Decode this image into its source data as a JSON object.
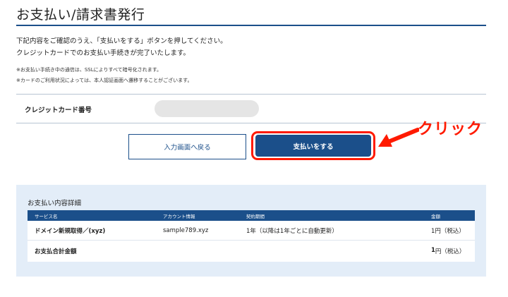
{
  "header": {
    "title": "お支払い/請求書発行"
  },
  "intro": {
    "line1": "下記内容をご確認のうえ、「支払いをする」ボタンを押してください。",
    "line2": "クレジットカードでのお支払い手続きが完了いたします。"
  },
  "notes": {
    "note1": "※お支払い手続き中の通信は、SSLによりすべて暗号化されます。",
    "note2": "※カードのご利用状況によっては、本人認証画面へ遷移することがございます。"
  },
  "card": {
    "label": "クレジットカード番号",
    "value": ""
  },
  "actions": {
    "back_label": "入力画面へ戻る",
    "pay_label": "支払いをする"
  },
  "annotation": {
    "text": "クリック",
    "color": "#ff1a00"
  },
  "details": {
    "title": "お支払い内容詳細",
    "columns": [
      "サービス名",
      "アカウント情報",
      "契約期間",
      "金額"
    ],
    "rows": [
      {
        "service": "ドメイン新規取得／(xyz)",
        "account": "sample789.xyz",
        "period": "1年（以降は1年ごとに自動更新）",
        "amount": "1円（税込）"
      }
    ],
    "total": {
      "label": "お支払合計金額",
      "amount_number": "1",
      "amount_suffix": "円（税込）"
    }
  },
  "colors": {
    "primary": "#1b4f8a",
    "panel": "#e3edf8",
    "highlight": "#ff1a00"
  }
}
